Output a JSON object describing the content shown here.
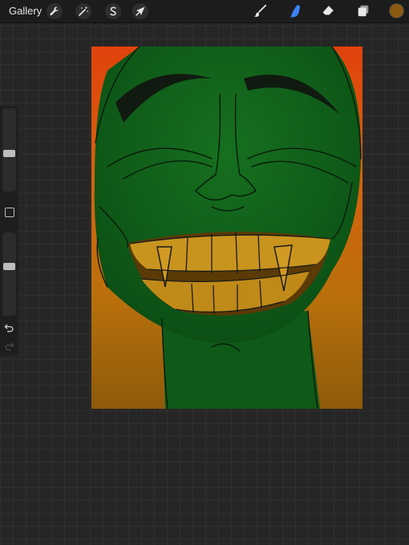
{
  "topbar": {
    "gallery_label": "Gallery",
    "left_tools": [
      {
        "name": "actions",
        "icon": "wrench-icon"
      },
      {
        "name": "adjustments",
        "icon": "magic-wand-icon"
      },
      {
        "name": "selection",
        "icon": "selection-s-icon"
      },
      {
        "name": "transform",
        "icon": "arrow-cursor-icon"
      }
    ],
    "right_tools": [
      {
        "name": "brush",
        "icon": "brush-icon",
        "active": false
      },
      {
        "name": "smudge",
        "icon": "smudge-finger-icon",
        "active": true
      },
      {
        "name": "eraser",
        "icon": "eraser-icon",
        "active": false
      },
      {
        "name": "layers",
        "icon": "layers-icon",
        "active": false
      }
    ],
    "current_color": "#8a5a12"
  },
  "sidebar": {
    "size_slider_level": 0.45,
    "opacity_slider_level": 0.6,
    "undo_icon": "undo-icon",
    "redo_icon": "redo-icon",
    "modify_icon": "square-icon"
  },
  "colors": {
    "accent_active": "#3b82f6",
    "skin": "#0f5a18",
    "background_orange": "#d0620f",
    "teeth": "#c8941e"
  }
}
